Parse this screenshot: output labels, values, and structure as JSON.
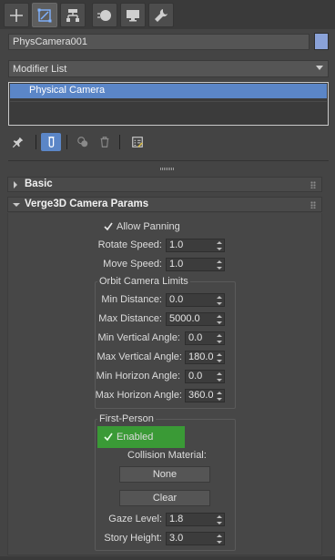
{
  "tabs": [
    {
      "icon": "plus-icon",
      "name": "create"
    },
    {
      "icon": "modify-icon",
      "name": "modify"
    },
    {
      "icon": "hierarchy-icon",
      "name": "hierarchy"
    },
    {
      "icon": "motion-icon",
      "name": "motion"
    },
    {
      "icon": "display-icon",
      "name": "display"
    },
    {
      "icon": "utilities-icon",
      "name": "utilities"
    }
  ],
  "object": {
    "name": "PhysCamera001",
    "color": "#8aa2d8"
  },
  "modifier_list": {
    "label": "Modifier List"
  },
  "stack": {
    "items": [
      "Physical Camera"
    ]
  },
  "rollouts": {
    "basic": {
      "title": "Basic"
    },
    "verge": {
      "title": "Verge3D Camera Params"
    }
  },
  "params": {
    "allow_panning": {
      "label": "Allow Panning",
      "checked": true
    },
    "rotate_speed": {
      "label": "Rotate Speed:",
      "value": "1.0"
    },
    "move_speed": {
      "label": "Move Speed:",
      "value": "1.0"
    },
    "orbit_limits": {
      "title": "Orbit Camera Limits",
      "min_distance": {
        "label": "Min Distance:",
        "value": "0.0"
      },
      "max_distance": {
        "label": "Max Distance:",
        "value": "5000.0"
      },
      "min_vertical": {
        "label": "Min Vertical Angle:",
        "value": "0.0"
      },
      "max_vertical": {
        "label": "Max Vertical Angle:",
        "value": "180.0"
      },
      "min_horizon": {
        "label": "Min Horizon Angle:",
        "value": "0.0"
      },
      "max_horizon": {
        "label": "Max Horizon Angle:",
        "value": "360.0"
      }
    },
    "first_person": {
      "title": "First-Person",
      "enabled": {
        "label": "Enabled",
        "checked": true
      },
      "collision_label": "Collision Material:",
      "none_button": "None",
      "clear_button": "Clear",
      "gaze_level": {
        "label": "Gaze Level:",
        "value": "1.8"
      },
      "story_height": {
        "label": "Story Height:",
        "value": "3.0"
      }
    }
  },
  "colors": {
    "panel": "#444444",
    "selection": "#5b86c7",
    "enabled_highlight": "#3a9a36"
  }
}
